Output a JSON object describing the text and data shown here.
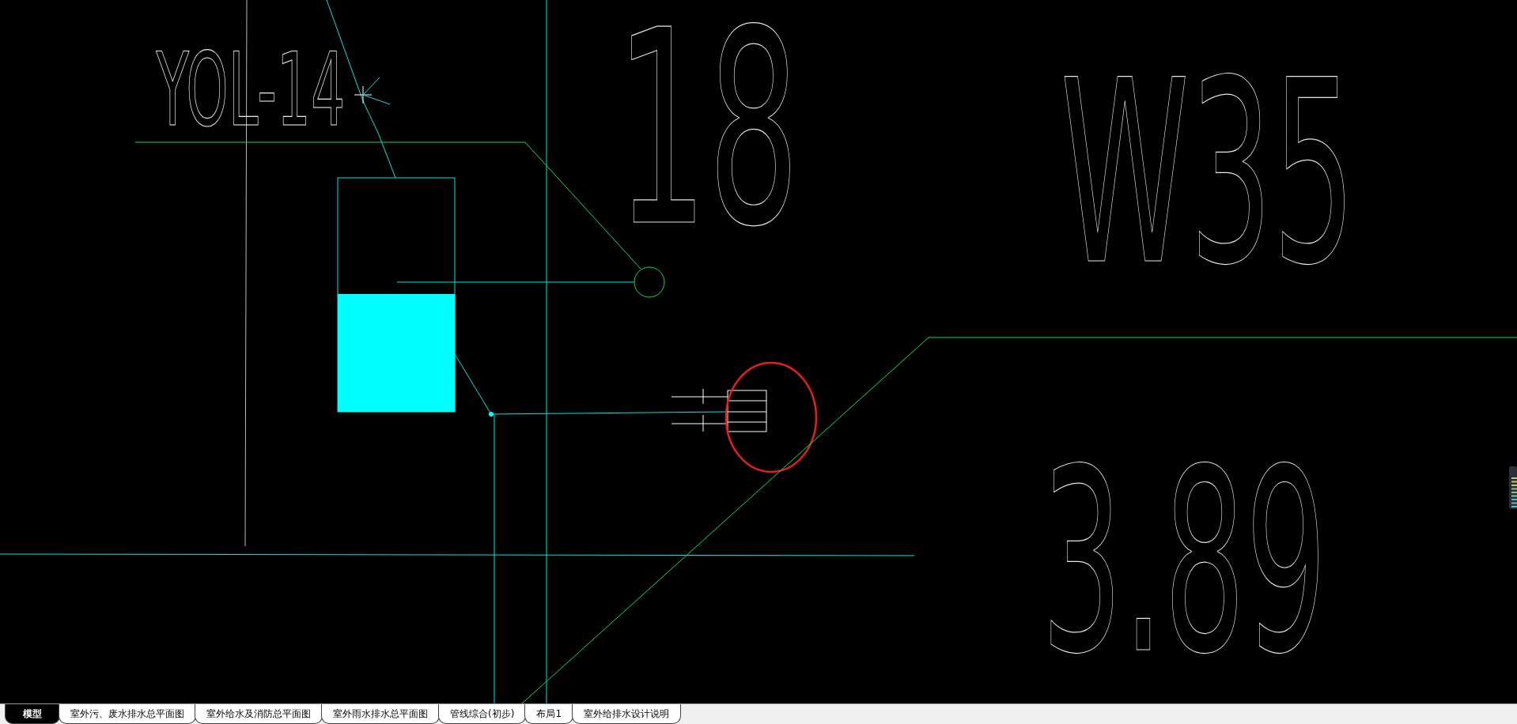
{
  "canvas": {
    "labels": [
      {
        "kind": "tag",
        "text": "YOL-14"
      },
      {
        "kind": "number",
        "text": "18"
      },
      {
        "kind": "code",
        "text": "W35"
      },
      {
        "kind": "elevation",
        "text": "3.89"
      }
    ]
  },
  "layout_tabs": [
    {
      "label": "模型",
      "selected": true
    },
    {
      "label": "室外污、废水排水总平面图",
      "selected": false
    },
    {
      "label": "室外给水及消防总平面图",
      "selected": false
    },
    {
      "label": "室外雨水排水总平面图",
      "selected": false
    },
    {
      "label": "管线综合(初步)",
      "selected": false
    },
    {
      "label": "布局1",
      "selected": false
    },
    {
      "label": "室外给排水设计说明",
      "selected": false
    }
  ]
}
